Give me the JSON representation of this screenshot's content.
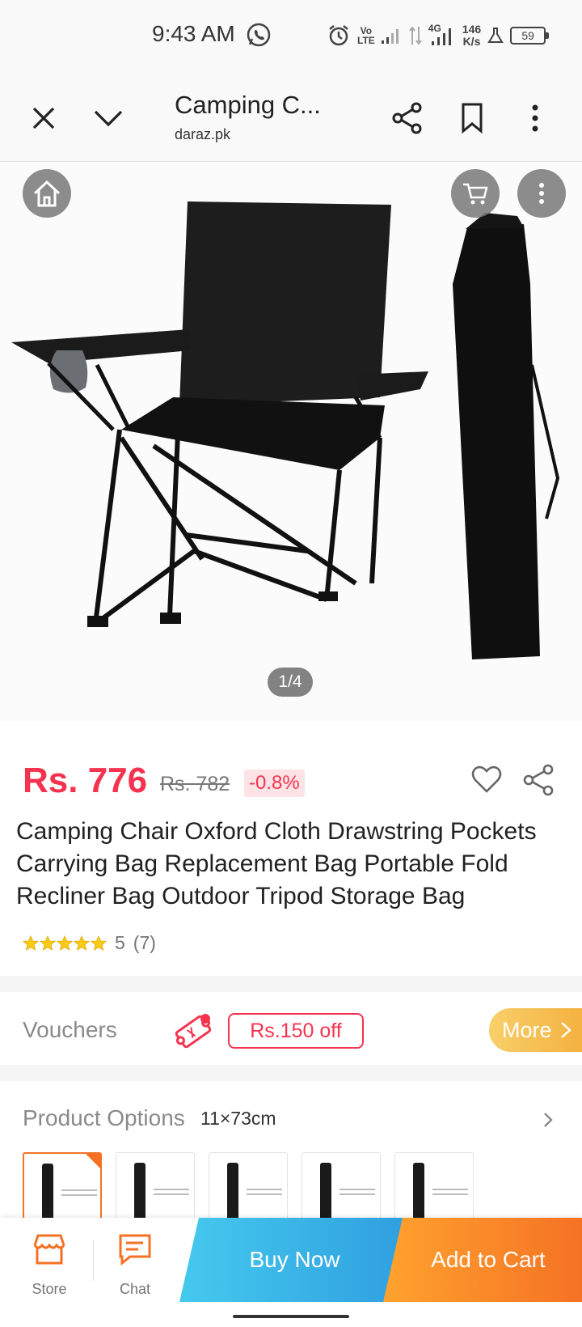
{
  "status_bar": {
    "time": "9:43 AM",
    "volte_top": "Vo",
    "volte_bottom": "LTE",
    "net_type": "4G",
    "speed_value": "146",
    "speed_unit": "K/s",
    "battery": "59",
    "icons": [
      "whatsapp-icon",
      "alarm-icon",
      "signal-icon",
      "data-arrows-icon",
      "flask-icon",
      "battery-icon"
    ]
  },
  "browser": {
    "title": "Camping C...",
    "domain": "daraz.pk",
    "icons": [
      "close-icon",
      "chevron-down-icon",
      "share-icon",
      "bookmark-icon",
      "more-vert-icon"
    ]
  },
  "gallery": {
    "counter": "1/4",
    "icons": [
      "home-icon",
      "cart-icon",
      "more-vert-icon"
    ]
  },
  "product": {
    "price": "Rs. 776",
    "old_price": "Rs. 782",
    "discount": "-0.8%",
    "title": "Camping Chair Oxford Cloth Drawstring Pockets Carrying Bag Replacement Bag Portable Fold Recliner Bag Outdoor Tripod Storage Bag",
    "rating_value": "5",
    "rating_count": "(7)",
    "stars": 5
  },
  "vouchers": {
    "label": "Vouchers",
    "chip": "Rs.150 off",
    "more": "More"
  },
  "options": {
    "label": "Product Options",
    "value": "11×73cm",
    "thumbnail_count": 5
  },
  "bottom_bar": {
    "store": "Store",
    "chat": "Chat",
    "buy_now": "Buy Now",
    "add_to_cart": "Add to Cart"
  },
  "colors": {
    "price": "#f5334f",
    "accent_orange": "#f57224",
    "buy_now": "#2f9fe0",
    "more_button": "#f4b03e"
  }
}
